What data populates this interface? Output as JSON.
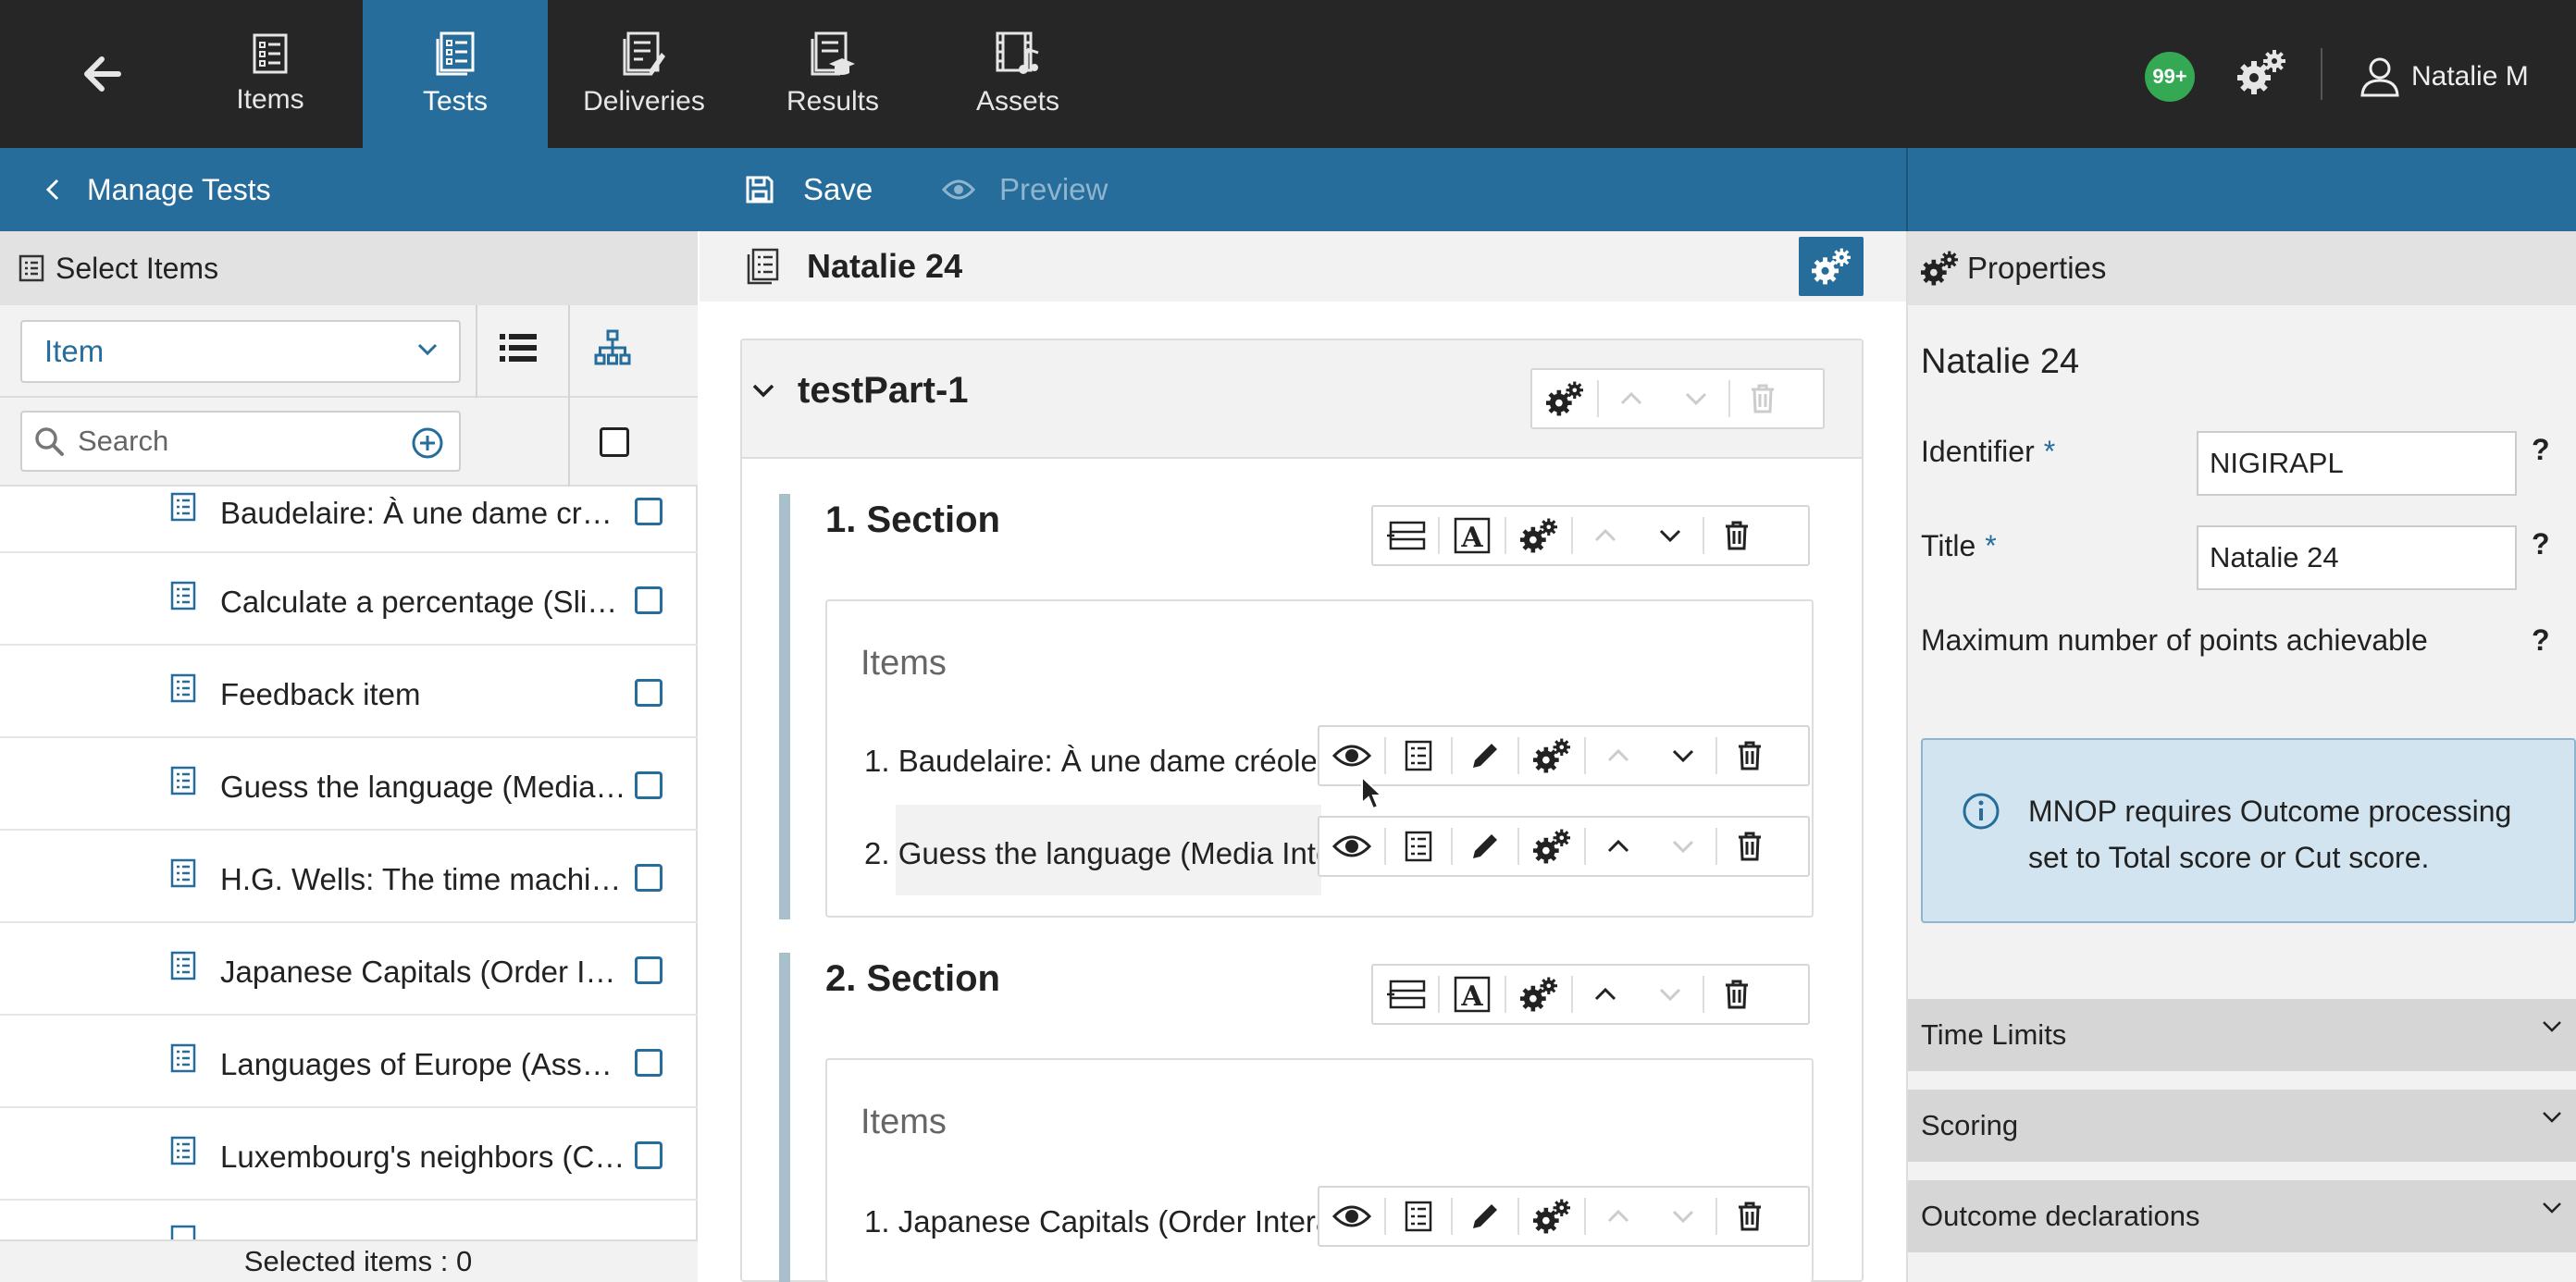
{
  "nav": {
    "items_label": "Items",
    "tests_label": "Tests",
    "deliveries_label": "Deliveries",
    "results_label": "Results",
    "assets_label": "Assets",
    "notifications_badge": "99+",
    "user_name": "Natalie M"
  },
  "actionbar": {
    "manage_label": "Manage Tests",
    "save_label": "Save",
    "preview_label": "Preview"
  },
  "left": {
    "header": "Select Items",
    "filter_value": "Item",
    "search_placeholder": "Search",
    "items": [
      "Baudelaire: À une dame cré…",
      "Calculate a percentage (Sli…",
      "Feedback item",
      "Guess the language (Media …",
      "H.G. Wells: The time machi…",
      "Japanese Capitals (Order In…",
      "Languages of Europe (Asso…",
      "Luxembourg's neighbors (C…"
    ],
    "footer": "Selected items : 0"
  },
  "center": {
    "test_title": "Natalie 24",
    "testpart_title": "testPart-1",
    "sections": [
      {
        "title": "1. Section",
        "items_label": "Items",
        "refs": [
          "1.  Baudelaire: À une dame créole",
          "2.  Guess the language (Media Inte"
        ]
      },
      {
        "title": "2. Section",
        "items_label": "Items",
        "refs": [
          "1.  Japanese Capitals (Order Intera"
        ]
      }
    ]
  },
  "right": {
    "header": "Properties",
    "name": "Natalie 24",
    "identifier_label": "Identifier",
    "identifier_value": "NIGIRAPL",
    "title_label": "Title",
    "title_value": "Natalie 24",
    "required_mark": "*",
    "help_mark": "?",
    "max_points_label": "Maximum number of points achievable",
    "info_message": "MNOP requires Outcome processing set to Total score or Cut score.",
    "accordions": [
      "Time Limits",
      "Scoring",
      "Outcome declarations"
    ]
  },
  "colors": {
    "topbar": "#262626",
    "accent": "#266d9c",
    "badge": "#34a853",
    "info_bg": "#d2e4ef"
  }
}
